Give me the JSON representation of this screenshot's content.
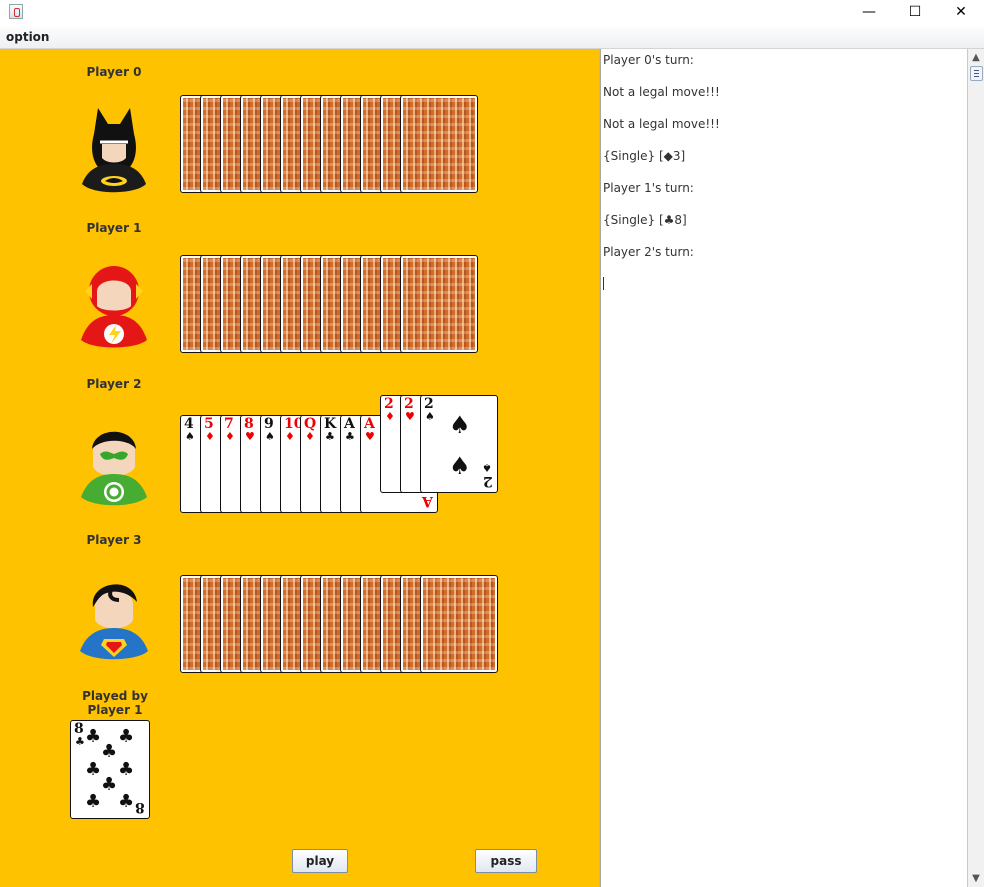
{
  "window": {
    "minimize_symbol": "—",
    "maximize_symbol": "☐",
    "close_symbol": "✕"
  },
  "menu": {
    "option_label": "option"
  },
  "players": [
    {
      "label": "Player 0",
      "avatar": "batman",
      "hand_count": 13
    },
    {
      "label": "Player 1",
      "avatar": "flash",
      "hand_count": 13
    },
    {
      "label": "Player 2",
      "avatar": "green-lantern",
      "hand_count": 13
    },
    {
      "label": "Player 3",
      "avatar": "superman",
      "hand_count": 13
    }
  ],
  "player2_hand": [
    {
      "rank": "4",
      "suit": "♠",
      "color": "black"
    },
    {
      "rank": "5",
      "suit": "♦",
      "color": "red"
    },
    {
      "rank": "7",
      "suit": "♦",
      "color": "red"
    },
    {
      "rank": "8",
      "suit": "♥",
      "color": "red"
    },
    {
      "rank": "9",
      "suit": "♠",
      "color": "black"
    },
    {
      "rank": "10",
      "suit": "♦",
      "color": "red"
    },
    {
      "rank": "Q",
      "suit": "♦",
      "color": "red"
    },
    {
      "rank": "K",
      "suit": "♣",
      "color": "black"
    },
    {
      "rank": "A",
      "suit": "♣",
      "color": "black"
    },
    {
      "rank": "A",
      "suit": "♥",
      "color": "red"
    },
    {
      "rank": "2",
      "suit": "♦",
      "color": "red"
    },
    {
      "rank": "2",
      "suit": "♥",
      "color": "red"
    },
    {
      "rank": "2",
      "suit": "♠",
      "color": "black"
    }
  ],
  "played": {
    "label": "Played by Player 1",
    "card": {
      "rank": "8",
      "suit": "♣",
      "color": "black"
    }
  },
  "buttons": {
    "play": "play",
    "pass": "pass"
  },
  "log": [
    "Player 0's turn:",
    "Not a legal move!!!",
    "Not a legal move!!!",
    "{Single} [◆3]",
    "Player 1's turn:",
    "{Single} [♣8]",
    "Player 2's turn:"
  ],
  "scrollbar": {
    "up": "▲",
    "down": "▼"
  }
}
